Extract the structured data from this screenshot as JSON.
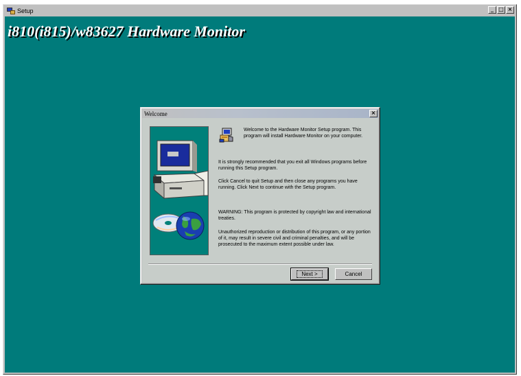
{
  "window": {
    "title": "Setup",
    "minimize_glyph": "_",
    "maximize_glyph": "□",
    "close_glyph": "×"
  },
  "banner": {
    "title": "i810(i815)/w83627 Hardware Monitor"
  },
  "dialog": {
    "title": "Welcome",
    "close_glyph": "×",
    "messages": [
      "Welcome to the Hardware Monitor Setup program. This program will install Hardware Monitor on your computer.",
      "It is strongly recommended that you exit all Windows programs before running this Setup program.",
      "Click Cancel to quit Setup and then close any programs you have running.  Click Next to continue with the Setup program.",
      "WARNING: This program is protected by copyright law and international treaties.",
      "Unauthorized reproduction or distribution of this program, or any portion of it, may result in severe civil and criminal penalties, and will be prosecuted to the maximum extent possible under law."
    ],
    "buttons": {
      "next": "Next >",
      "cancel": "Cancel"
    }
  },
  "colors": {
    "desktop": "#007b7b",
    "dialog_face": "#c0c0c0",
    "dialog_body": "#c7cdc9",
    "side_panel": "#00807a",
    "banner_text": "#ffffff"
  },
  "icons": {
    "app": "setup-computer-icon",
    "setup": "setup-installer-icon",
    "side_image": "computer-with-cd-and-globe"
  }
}
